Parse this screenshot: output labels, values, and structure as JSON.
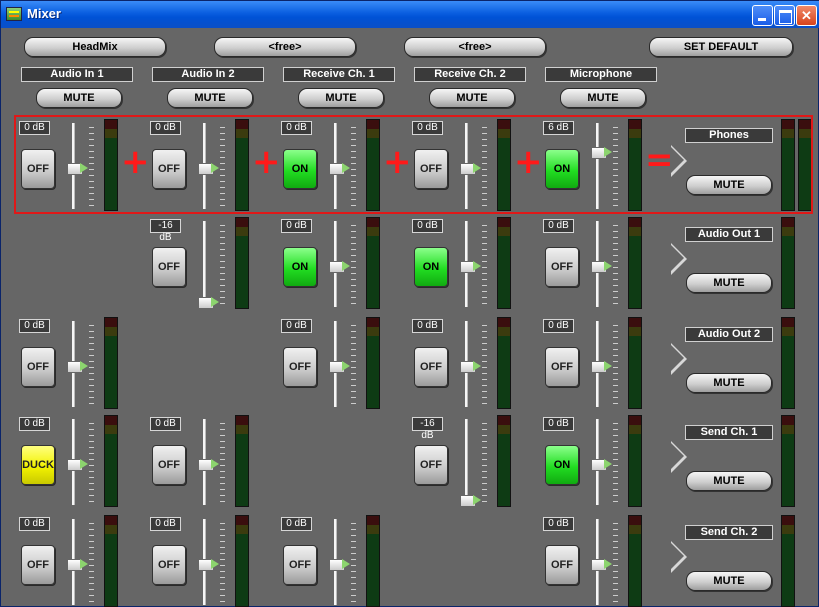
{
  "window": {
    "title": "Mixer",
    "controls": {
      "minimize": "minimize-icon",
      "maximize": "maximize-icon",
      "close": "close-icon"
    }
  },
  "toolbar": {
    "headmix_label": "HeadMix",
    "free1_label": "<free>",
    "free2_label": "<free>",
    "set_default_label": "SET DEFAULT"
  },
  "inputs": [
    {
      "name": "Audio In 1",
      "mute": "MUTE"
    },
    {
      "name": "Audio In 2",
      "mute": "MUTE"
    },
    {
      "name": "Receive Ch. 1",
      "mute": "MUTE"
    },
    {
      "name": "Receive Ch. 2",
      "mute": "MUTE"
    },
    {
      "name": "Microphone",
      "mute": "MUTE"
    }
  ],
  "outputs": [
    {
      "name": "Phones",
      "mute": "MUTE",
      "cells": [
        {
          "db": "0 dB",
          "state": "OFF",
          "level": 0.5
        },
        {
          "db": "0 dB",
          "state": "OFF",
          "level": 0.5
        },
        {
          "db": "0 dB",
          "state": "ON",
          "level": 0.5
        },
        {
          "db": "0 dB",
          "state": "OFF",
          "level": 0.5
        },
        {
          "db": "6 dB",
          "state": "ON",
          "level": 0.3
        }
      ]
    },
    {
      "name": "Audio Out 1",
      "mute": "MUTE",
      "cells": [
        null,
        {
          "db": "-16 dB",
          "state": "OFF",
          "level": 0.95
        },
        {
          "db": "0 dB",
          "state": "ON",
          "level": 0.5
        },
        {
          "db": "0 dB",
          "state": "ON",
          "level": 0.5
        },
        {
          "db": "0 dB",
          "state": "OFF",
          "level": 0.5
        }
      ]
    },
    {
      "name": "Audio Out 2",
      "mute": "MUTE",
      "cells": [
        {
          "db": "0 dB",
          "state": "OFF",
          "level": 0.5
        },
        null,
        {
          "db": "0 dB",
          "state": "OFF",
          "level": 0.5
        },
        {
          "db": "0 dB",
          "state": "OFF",
          "level": 0.5
        },
        {
          "db": "0 dB",
          "state": "OFF",
          "level": 0.5
        }
      ]
    },
    {
      "name": "Send Ch. 1",
      "mute": "MUTE",
      "cells": [
        {
          "db": "0 dB",
          "state": "DUCK",
          "level": 0.5
        },
        {
          "db": "0 dB",
          "state": "OFF",
          "level": 0.5
        },
        null,
        {
          "db": "-16 dB",
          "state": "OFF",
          "level": 0.95
        },
        {
          "db": "0 dB",
          "state": "ON",
          "level": 0.5
        }
      ]
    },
    {
      "name": "Send Ch. 2",
      "mute": "MUTE",
      "cells": [
        {
          "db": "0 dB",
          "state": "OFF",
          "level": 0.5
        },
        {
          "db": "0 dB",
          "state": "OFF",
          "level": 0.5
        },
        {
          "db": "0 dB",
          "state": "OFF",
          "level": 0.5
        },
        null,
        {
          "db": "0 dB",
          "state": "OFF",
          "level": 0.5
        }
      ]
    }
  ],
  "operators": {
    "plus": "+",
    "equals": "="
  },
  "colors": {
    "on": "#22dd22",
    "duck": "#f2f200",
    "highlight": "#e01818",
    "operator": "#ff1a1a"
  }
}
